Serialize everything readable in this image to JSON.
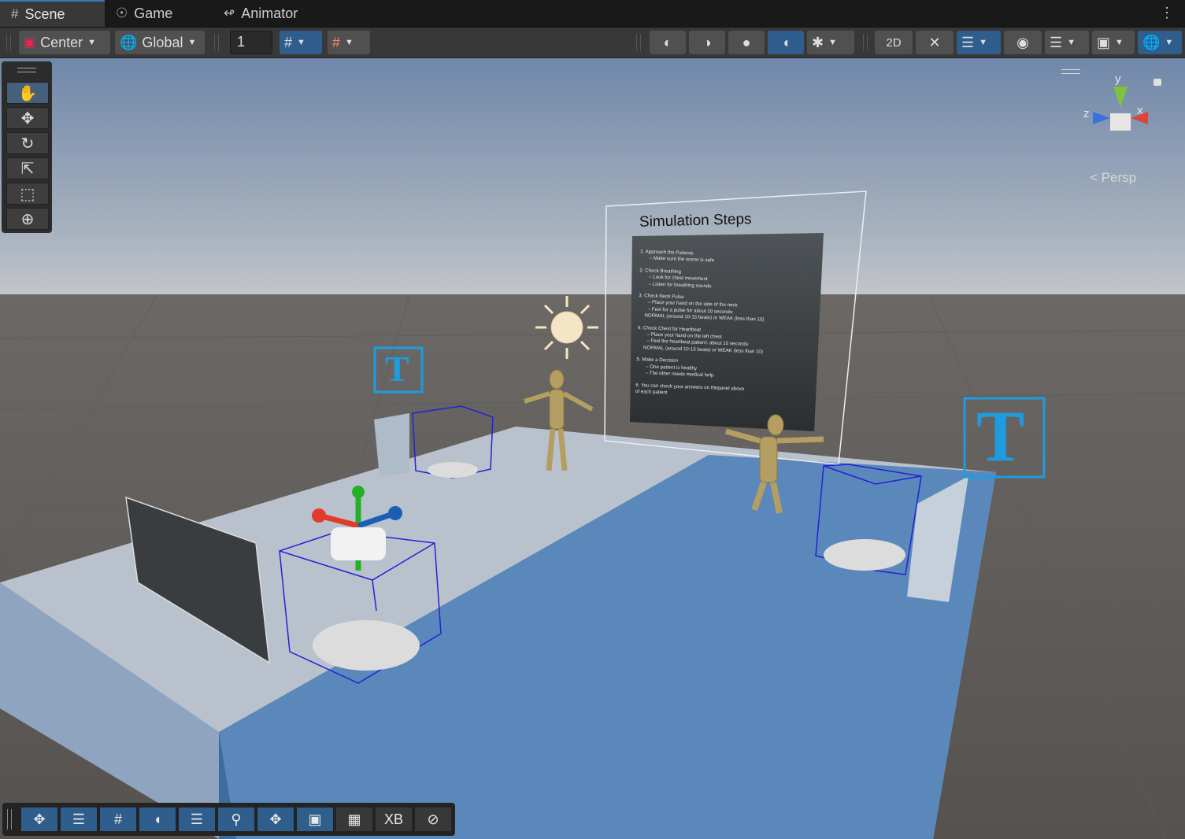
{
  "tabs": [
    {
      "label": "Scene",
      "icon": "grid-icon"
    },
    {
      "label": "Game",
      "icon": "gamepad-icon"
    },
    {
      "label": "Animator",
      "icon": "animator-icon"
    }
  ],
  "toolbar": {
    "pivot_label": "Center",
    "space_label": "Global",
    "grid_increment_value": "1"
  },
  "scene": {
    "panel_title": "Simulation Steps",
    "steps": [
      "1. Approach the Patients",
      "– Make sure the scene is safe",
      "2. Check Breathing",
      "– Look for chest movement",
      "– Listen for breathing sounds",
      "3. Check Neck Pulse",
      "– Place your hand on the side of the neck",
      "– Feel for a pulse for about 10 seconds:",
      "NORMAL (around 10-15 beats) or WEAK (less than 10)",
      "4. Check Chest for Heartbeat",
      "– Place your hand on the left chest",
      "– Feel the heartbeat pattern: about 10 seconds:",
      "NORMAL (around 10-15 beats) or WEAK (less than 10)",
      "5. Make a Decision",
      "– One patient is healthy",
      "– The other needs medical help",
      "6. You can check your answers on thepanel above",
      "of each patient"
    ],
    "text_icon_glyph": "T",
    "camera_mode": "Persp",
    "gizmo_axes": {
      "x": "x",
      "y": "y",
      "z": "z"
    }
  },
  "overlay": {
    "xr_label": "XB"
  },
  "colors": {
    "accent": "#2f5d8c",
    "selection_blue": "#1f9be0",
    "floor_blue": "#5b88bb",
    "floor_grey": "#b9c2cc"
  }
}
